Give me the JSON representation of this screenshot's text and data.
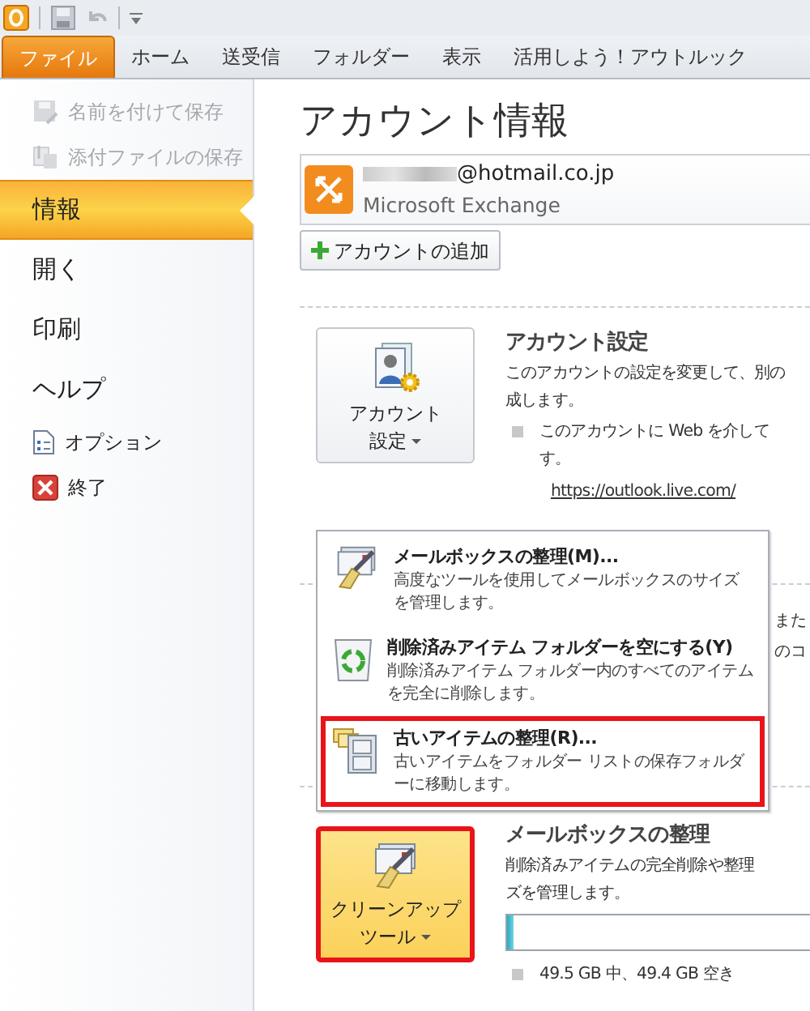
{
  "ribbon_tabs": [
    {
      "label": "ファイル",
      "selected": true
    },
    {
      "label": "ホーム",
      "selected": false
    },
    {
      "label": "送受信",
      "selected": false
    },
    {
      "label": "フォルダー",
      "selected": false
    },
    {
      "label": "表示",
      "selected": false
    },
    {
      "label": "活用しよう！アウトルック",
      "selected": false
    }
  ],
  "sidebar": {
    "items": [
      {
        "label": "名前を付けて保存",
        "kind": "command",
        "disabled": true,
        "selected": false
      },
      {
        "label": "添付ファイルの保存",
        "kind": "command",
        "disabled": true,
        "selected": false
      },
      {
        "label": "情報",
        "kind": "page",
        "disabled": false,
        "selected": true
      },
      {
        "label": "開く",
        "kind": "page",
        "disabled": false,
        "selected": false
      },
      {
        "label": "印刷",
        "kind": "page",
        "disabled": false,
        "selected": false
      },
      {
        "label": "ヘルプ",
        "kind": "page",
        "disabled": false,
        "selected": false
      },
      {
        "label": "オプション",
        "kind": "command",
        "disabled": false,
        "selected": false
      },
      {
        "label": "終了",
        "kind": "command",
        "disabled": false,
        "selected": false
      }
    ]
  },
  "title": "アカウント情報",
  "account": {
    "address": "@hotmail.co.jp",
    "type": "Microsoft Exchange"
  },
  "add_account_button": "アカウントの追加",
  "account_settings": {
    "button_lines": [
      "アカウント",
      "設定"
    ],
    "heading": "アカウント設定",
    "description": [
      "このアカウントの設定を変更して、別の",
      "成します。"
    ],
    "bullet_lines": [
      "このアカウントに Web を介して",
      "す。"
    ],
    "link": "https://outlook.live.com/"
  },
  "hidden_section_fragments": [
    "また",
    "のコ"
  ],
  "cleanup_menu": [
    {
      "title": "メールボックスの整理(M)...",
      "description": "高度なツールを使用してメールボックスのサイズを管理します。",
      "highlighted": false
    },
    {
      "title": "削除済みアイテム フォルダーを空にする(Y)",
      "description": "削除済みアイテム フォルダー内のすべてのアイテムを完全に削除します。",
      "highlighted": false
    },
    {
      "title": "古いアイテムの整理(R)...",
      "description": "古いアイテムをフォルダー リストの保存フォルダーに移動します。",
      "highlighted": true
    }
  ],
  "mailbox_cleanup": {
    "button_lines": [
      "クリーンアップ",
      "ツール"
    ],
    "button_highlighted": true,
    "heading": "メールボックスの整理",
    "description": [
      "削除済みアイテムの完全削除や整理",
      "ズを管理します。"
    ],
    "level": 0.02,
    "usage": "49.5 GB 中、49.4 GB 空き"
  }
}
